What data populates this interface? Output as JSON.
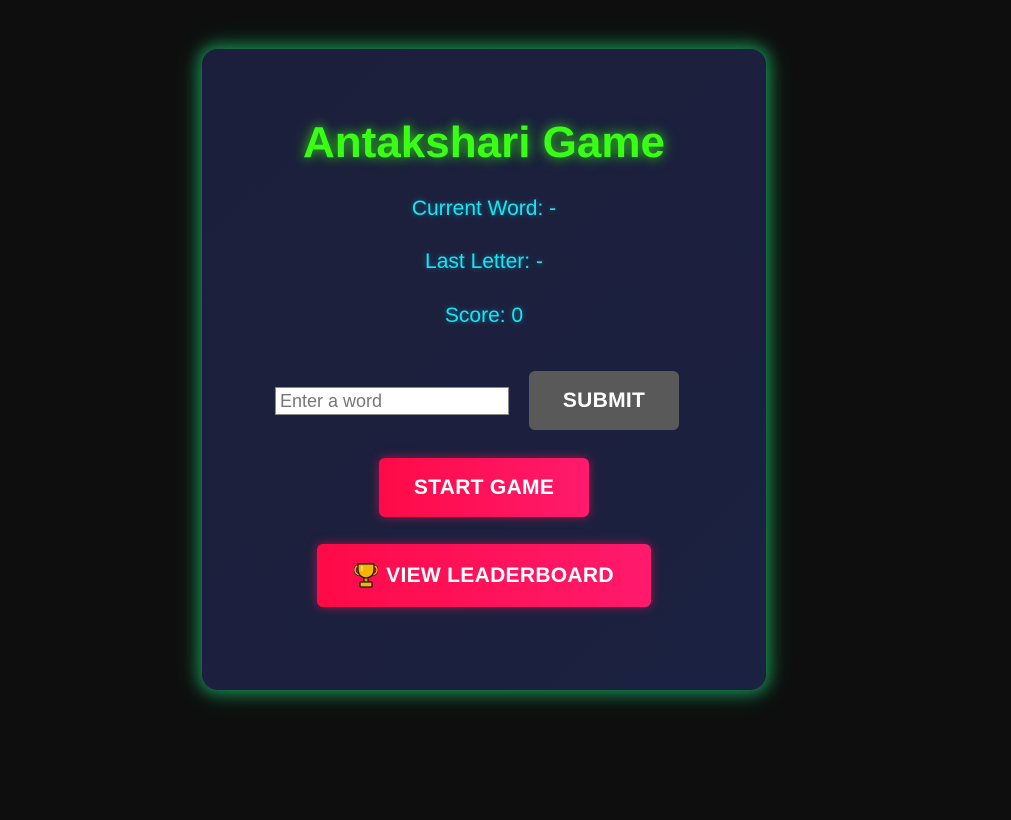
{
  "game": {
    "title": "Antakshari Game",
    "current_word": "Current Word: -",
    "last_letter": "Last Letter: -",
    "score": "Score: 0"
  },
  "input": {
    "placeholder": "Enter a word",
    "value": ""
  },
  "buttons": {
    "submit_label": "SUBMIT",
    "start_label": "START GAME",
    "leaderboard_label": "VIEW LEADERBOARD",
    "leaderboard_icon": "trophy-icon"
  },
  "colors": {
    "background": "#0e0e0e",
    "card": "#1c1f3b",
    "card_glow": "#1ed278",
    "title": "#39ff14",
    "info_text": "#17e5f5",
    "submit_button": "#595959",
    "accent_button": "#ff1050"
  }
}
